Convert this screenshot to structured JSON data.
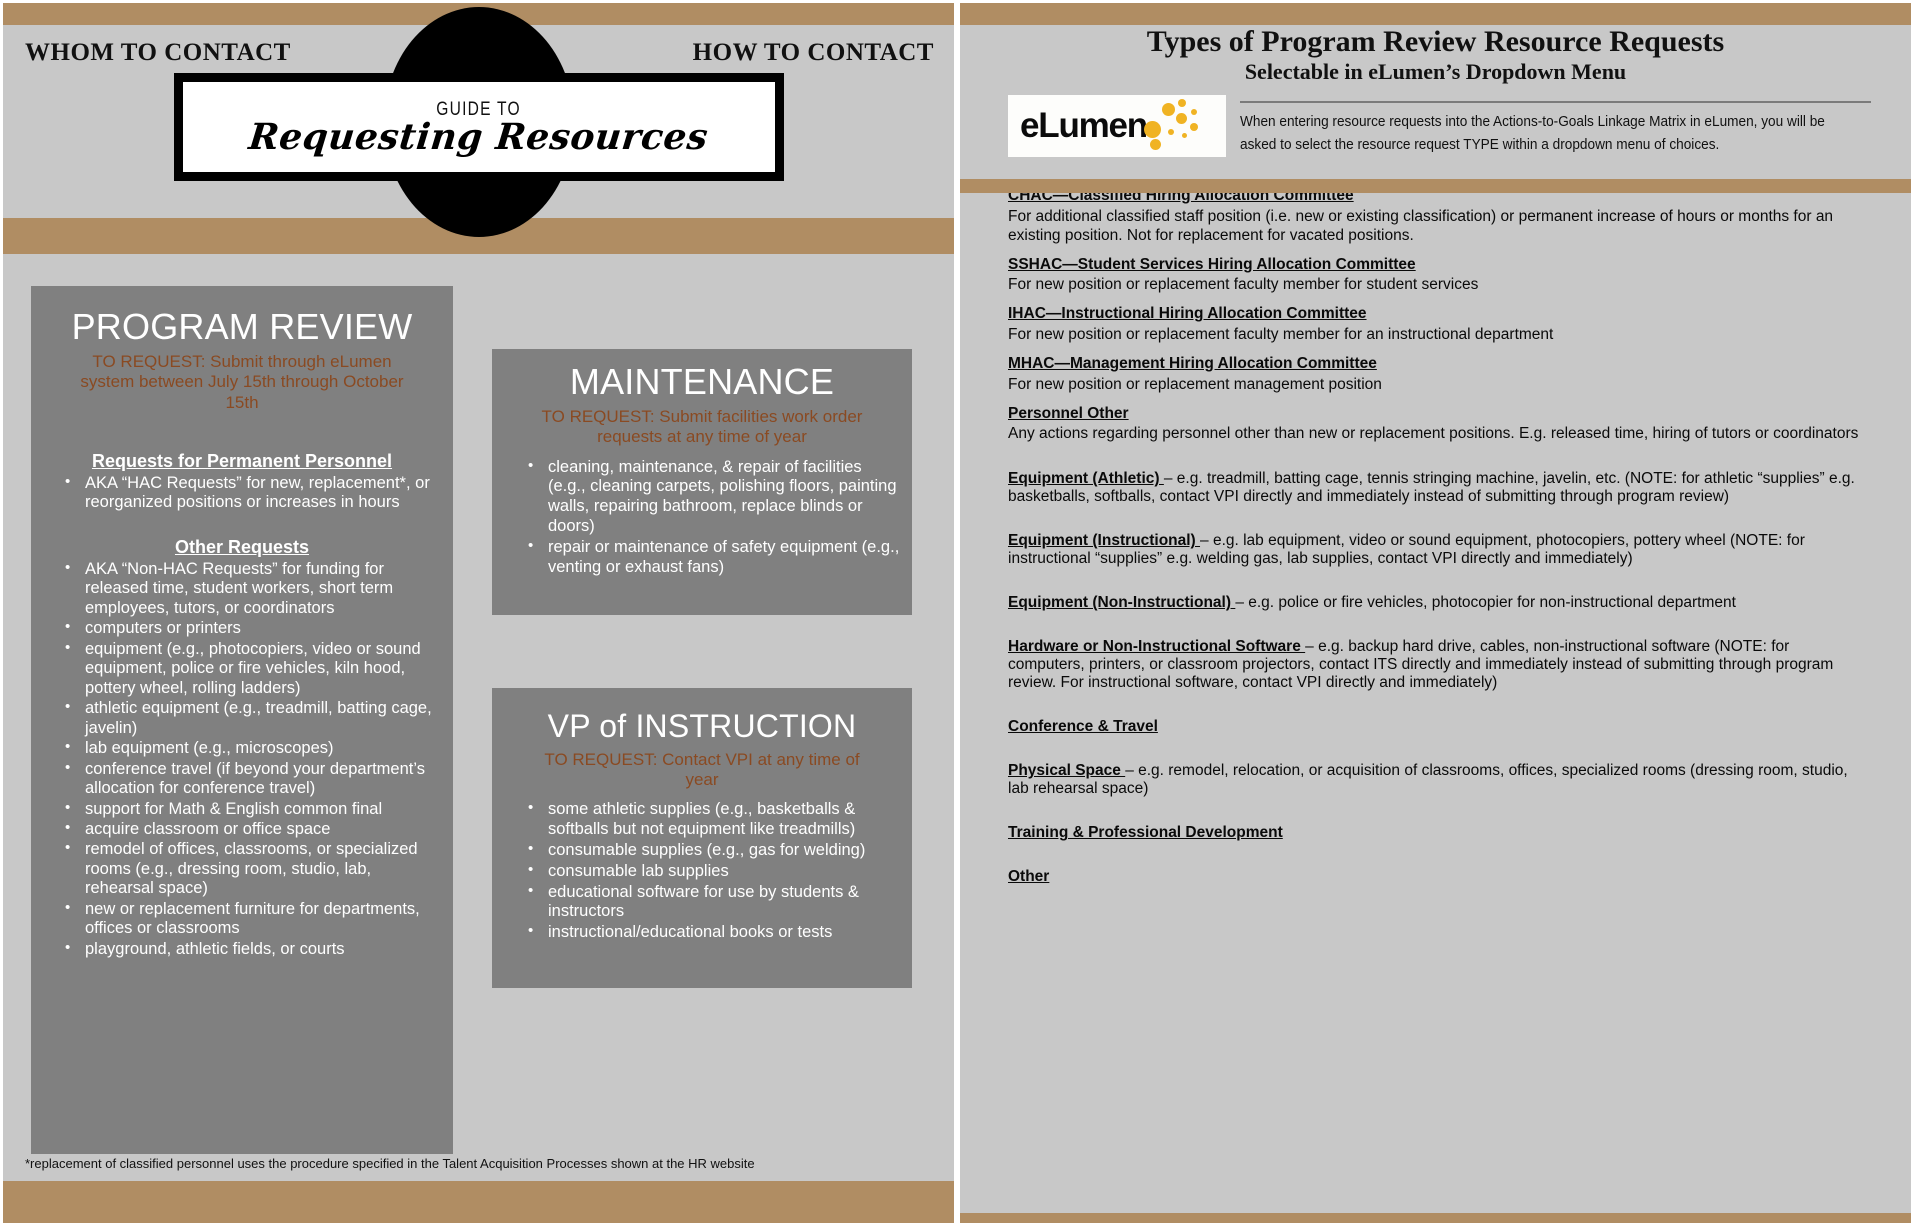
{
  "left": {
    "header_left": "WHOM TO CONTACT",
    "header_right": "HOW TO CONTACT",
    "guide_to": "GUIDE TO",
    "title": "Requesting Resources",
    "footnote": "*replacement of classified personnel uses the procedure specified in the Talent Acquisition Processes shown at the HR website",
    "program_review": {
      "title": "PROGRAM REVIEW",
      "to_request": "TO REQUEST:  Submit through eLumen system between July 15th through October 15th",
      "section1_heading": "Requests for Permanent Personnel",
      "section1_items": [
        "AKA “HAC Requests” for new, replacement*, or reorganized positions or increases in hours"
      ],
      "section2_heading": "Other Requests",
      "section2_items": [
        "AKA “Non-HAC Requests” for funding for released time, student workers, short term employees, tutors, or coordinators",
        "computers or printers",
        "equipment (e.g., photocopiers, video or sound equipment, police or fire vehicles, kiln hood, pottery wheel, rolling ladders)",
        "athletic equipment (e.g., treadmill, batting cage, javelin)",
        "lab equipment (e.g., microscopes)",
        "conference travel (if beyond your department’s allocation for conference travel)",
        "support  for Math & English common final",
        "acquire classroom or office space",
        "remodel of offices, classrooms, or specialized rooms (e.g., dressing room, studio, lab, rehearsal space)",
        "new or replacement furniture for departments, offices or classrooms",
        "playground, athletic fields, or courts"
      ]
    },
    "maintenance": {
      "title": "MAINTENANCE",
      "to_request": "TO REQUEST:  Submit facilities work order requests at any time of year",
      "items": [
        "cleaning, maintenance, & repair of facilities (e.g., cleaning carpets, polishing floors, painting walls, repairing bathroom, replace blinds or doors)",
        "repair or maintenance of safety equipment (e.g., venting or exhaust fans)"
      ]
    },
    "vpi": {
      "title": "VP of INSTRUCTION",
      "to_request": "TO REQUEST:  Contact VPI at any time of year",
      "items": [
        "some athletic supplies (e.g., basketballs & softballs but not equipment like treadmills)",
        "consumable supplies (e.g., gas for welding)",
        "consumable lab supplies",
        "educational software for use by students & instructors",
        "instructional/educational books or tests"
      ]
    }
  },
  "right": {
    "title": "Types of Program Review Resource Requests",
    "subtitle": "Selectable in eLumen’s Dropdown Menu",
    "logo_text": "eLumen",
    "intro": "When entering resource requests into the Actions-to-Goals Linkage Matrix in eLumen, you will be asked to select the resource request TYPE within a dropdown menu of choices.",
    "entries": [
      {
        "heading": "CHAC—Classified Hiring Allocation Committee",
        "desc": "For additional classified staff position (i.e. new or existing classification) or permanent increase of hours or months for an existing position.  Not for replacement for vacated positions.",
        "gap": false
      },
      {
        "heading": "SSHAC—Student Services Hiring Allocation Committee",
        "desc": "For new position or replacement faculty member for student services",
        "gap": false
      },
      {
        "heading": "IHAC—Instructional Hiring Allocation Committee",
        "desc": "For new position or replacement faculty member for an instructional department",
        "gap": false
      },
      {
        "heading": "MHAC—Management Hiring Allocation Committee",
        "desc": "For new position or replacement management position",
        "gap": false
      },
      {
        "heading": "Personnel Other",
        "desc": "Any actions regarding personnel other than new or replacement positions.  E.g. released time, hiring of tutors or coordinators",
        "gap": false
      },
      {
        "heading": "Equipment (Athletic) ",
        "inline": "– e.g. treadmill, batting cage, tennis stringing machine, javelin, etc.  (NOTE: for athletic “supplies” e.g. basketballs, softballs, contact VPI directly and immediately instead of submitting through program review)",
        "gap": true
      },
      {
        "heading": "Equipment (Instructional) ",
        "inline": "– e.g. lab equipment, video or sound equipment, photocopiers, pottery wheel (NOTE: for instructional “supplies” e.g. welding gas, lab supplies, contact VPI directly and immediately)",
        "gap": false
      },
      {
        "heading": "Equipment (Non-Instructional) ",
        "inline": "– e.g. police or fire vehicles, photocopier for non-instructional department",
        "gap": false
      },
      {
        "heading": "Hardware or Non-Instructional Software ",
        "inline": "– e.g. backup hard drive, cables, non-instructional software (NOTE: for computers, printers, or classroom projectors, contact ITS directly and immediately instead of submitting through program review.  For instructional software, contact VPI directly and immediately)",
        "gap": false
      },
      {
        "heading": "Conference & Travel",
        "inline": "",
        "gap": false
      },
      {
        "heading": "Physical Space ",
        "inline": "– e.g. remodel, relocation, or acquisition of classrooms, offices, specialized rooms (dressing room, studio, lab rehearsal space)",
        "gap": false
      },
      {
        "heading": "Training & Professional Development",
        "inline": "",
        "gap": false
      },
      {
        "heading": "Other",
        "inline": "",
        "gap": false
      }
    ]
  },
  "colors": {
    "band": "#b08d63",
    "panel_bg": "#c8c8c8",
    "box_bg": "#808080",
    "accent_text": "#8a4a22",
    "logo_dot": "#f0b323"
  }
}
